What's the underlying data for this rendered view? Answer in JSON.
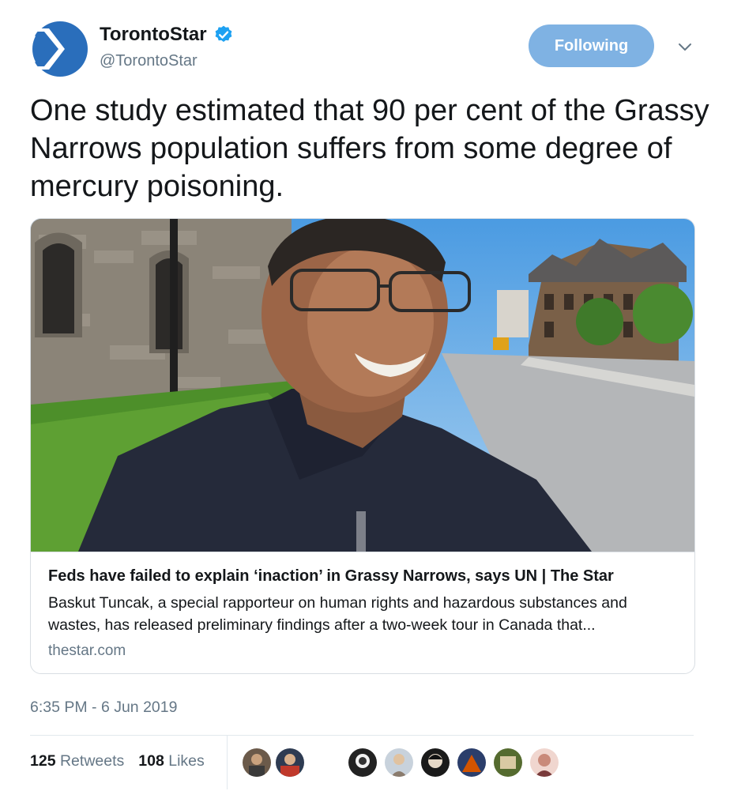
{
  "account": {
    "display_name": "TorontoStar",
    "handle": "@TorontoStar",
    "verified": true,
    "logo_icon": "toronto-star-logo-icon",
    "brand_color": "#2a6ebb"
  },
  "follow_button": {
    "label": "Following",
    "color": "#7fb2e3"
  },
  "tweet": {
    "text": "One study estimated that 90 per cent of the Grassy Narrows population suffers from some degree of mercury poisoning."
  },
  "card": {
    "title": "Feds have failed to explain ‘inaction’ in Grassy Narrows, says UN | The Star",
    "description": "Baskut Tuncak, a special rapporteur on human rights and hazardous substances and wastes, has released preliminary findings after a two-week tour in Canada that...",
    "domain": "thestar.com"
  },
  "timestamp": "6:35 PM - 6 Jun 2019",
  "stats": {
    "retweets_count": "125",
    "retweets_label": "Retweets",
    "likes_count": "108",
    "likes_label": "Likes"
  },
  "liker_avatars": [
    "avatar-1",
    "avatar-2",
    "avatar-3",
    "avatar-4",
    "avatar-5",
    "avatar-6",
    "avatar-7",
    "avatar-8"
  ],
  "colors": {
    "text": "#14171a",
    "secondary": "#657786",
    "verified": "#1da1f2",
    "border": "#d9dee3"
  }
}
